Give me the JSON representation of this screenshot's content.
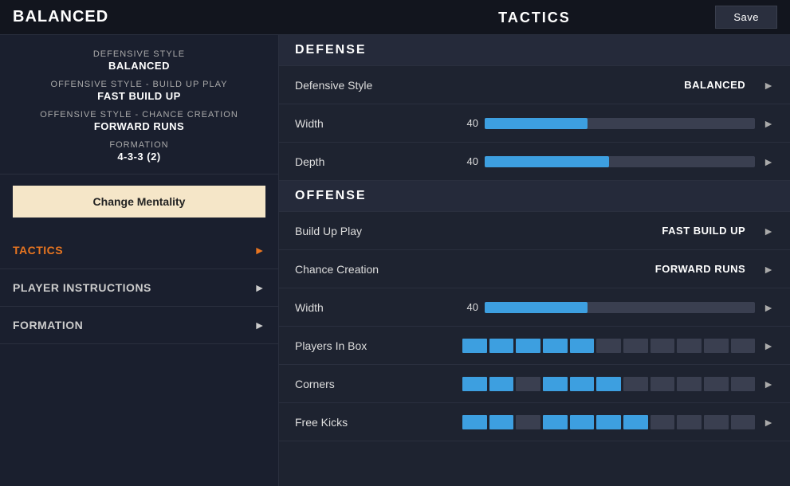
{
  "header": {
    "title": "BALANCED",
    "save_label": "Save",
    "tactics_label": "TACTICS"
  },
  "sidebar": {
    "summary_items": [
      {
        "label": "DEFENSIVE STYLE",
        "value": "BALANCED"
      },
      {
        "label": "OFFENSIVE STYLE - BUILD UP PLAY",
        "value": "FAST BUILD UP"
      },
      {
        "label": "OFFENSIVE STYLE - CHANCE CREATION",
        "value": "FORWARD RUNS"
      },
      {
        "label": "FORMATION",
        "value": "4-3-3 (2)"
      }
    ],
    "change_mentality_label": "Change Mentality",
    "nav_items": [
      {
        "label": "Tactics",
        "active": true
      },
      {
        "label": "Player Instructions",
        "active": false
      },
      {
        "label": "Formation",
        "active": false
      }
    ]
  },
  "defense": {
    "section_label": "DEFENSE",
    "rows": [
      {
        "type": "text",
        "label": "Defensive Style",
        "value": "BALANCED"
      },
      {
        "type": "slider",
        "label": "Width",
        "number": "40",
        "fill_pct": 38
      },
      {
        "type": "slider",
        "label": "Depth",
        "number": "40",
        "fill_pct": 46
      }
    ]
  },
  "offense": {
    "section_label": "OFFENSE",
    "rows": [
      {
        "type": "text",
        "label": "Build Up Play",
        "value": "FAST BUILD UP"
      },
      {
        "type": "text",
        "label": "Chance Creation",
        "value": "FORWARD RUNS"
      },
      {
        "type": "slider",
        "label": "Width",
        "number": "40",
        "fill_pct": 38
      },
      {
        "type": "segments",
        "label": "Players In Box",
        "segments": [
          1,
          1,
          1,
          1,
          1,
          0,
          0,
          0,
          0,
          0,
          0
        ]
      },
      {
        "type": "segments",
        "label": "Corners",
        "segments": [
          1,
          1,
          0,
          1,
          1,
          1,
          0,
          0,
          0,
          0,
          0
        ]
      },
      {
        "type": "segments",
        "label": "Free Kicks",
        "segments": [
          1,
          1,
          0,
          1,
          1,
          1,
          1,
          0,
          0,
          0,
          0
        ]
      }
    ]
  },
  "colors": {
    "accent_orange": "#e87520",
    "slider_fill": "#3d9fe0",
    "slider_empty": "#3a3f50",
    "active_nav": "#e87520"
  }
}
